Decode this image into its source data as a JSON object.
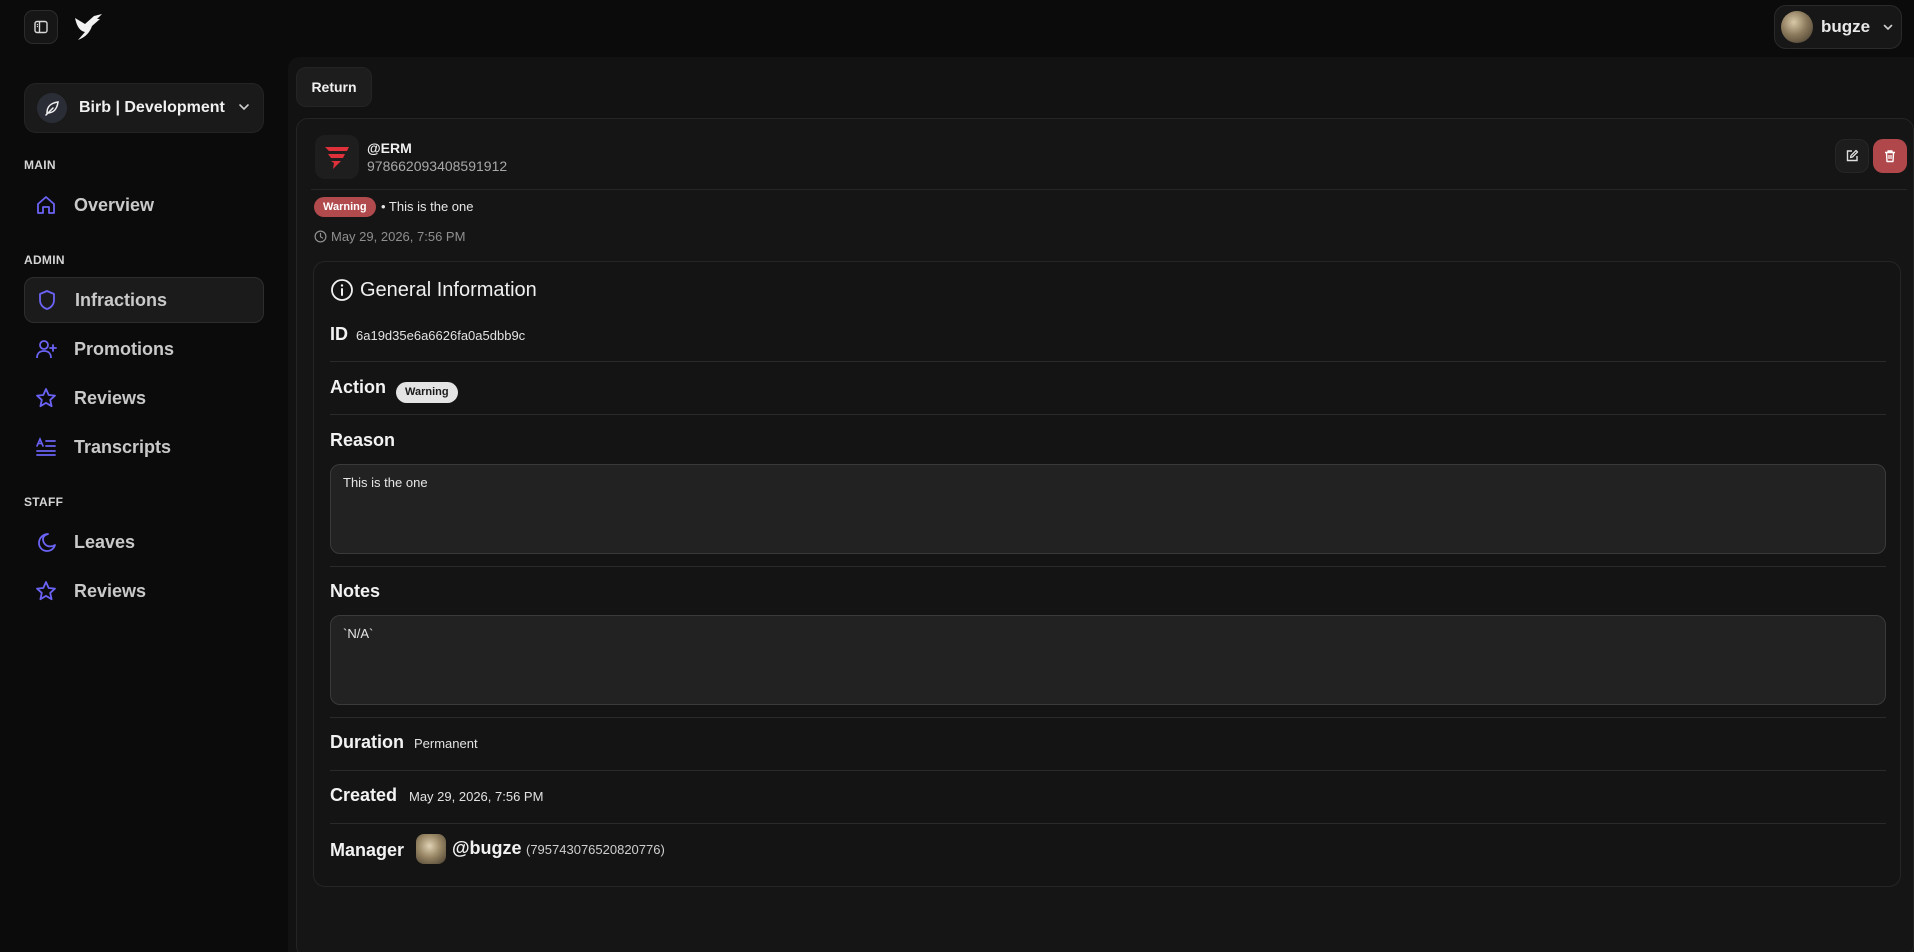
{
  "user": {
    "name": "bugze"
  },
  "workspace": {
    "name": "Birb | Development"
  },
  "sidebar": {
    "sections": [
      {
        "title": "MAIN",
        "items": [
          {
            "label": "Overview",
            "icon": "home-icon"
          }
        ]
      },
      {
        "title": "ADMIN",
        "items": [
          {
            "label": "Infractions",
            "icon": "shield-icon",
            "active": true
          },
          {
            "label": "Promotions",
            "icon": "user-plus-icon"
          },
          {
            "label": "Reviews",
            "icon": "star-icon"
          },
          {
            "label": "Transcripts",
            "icon": "text-lines-icon"
          }
        ]
      },
      {
        "title": "STAFF",
        "items": [
          {
            "label": "Leaves",
            "icon": "moon-icon"
          },
          {
            "label": "Reviews",
            "icon": "star-icon"
          }
        ]
      }
    ]
  },
  "main": {
    "return_label": "Return",
    "header": {
      "handle": "@ERM",
      "user_id": "978662093408591912",
      "badge": "Warning",
      "summary": "• This is the one",
      "timestamp": "May 29, 2026, 7:56 PM"
    },
    "info": {
      "title": "General Information",
      "id_label": "ID",
      "id_value": "6a19d35e6a6626fa0a5dbb9c",
      "action_label": "Action",
      "action_value": "Warning",
      "reason_label": "Reason",
      "reason_value": "This is the one",
      "notes_label": "Notes",
      "notes_value": "`N/A`",
      "duration_label": "Duration",
      "duration_value": "Permanent",
      "created_label": "Created",
      "created_value": "May 29, 2026, 7:56 PM",
      "manager_label": "Manager",
      "manager_handle": "@bugze",
      "manager_id": "(795743076520820776)"
    }
  },
  "colors": {
    "accent": "#6b63f5",
    "danger": "#b0484b",
    "background": "#0b0b0b"
  }
}
